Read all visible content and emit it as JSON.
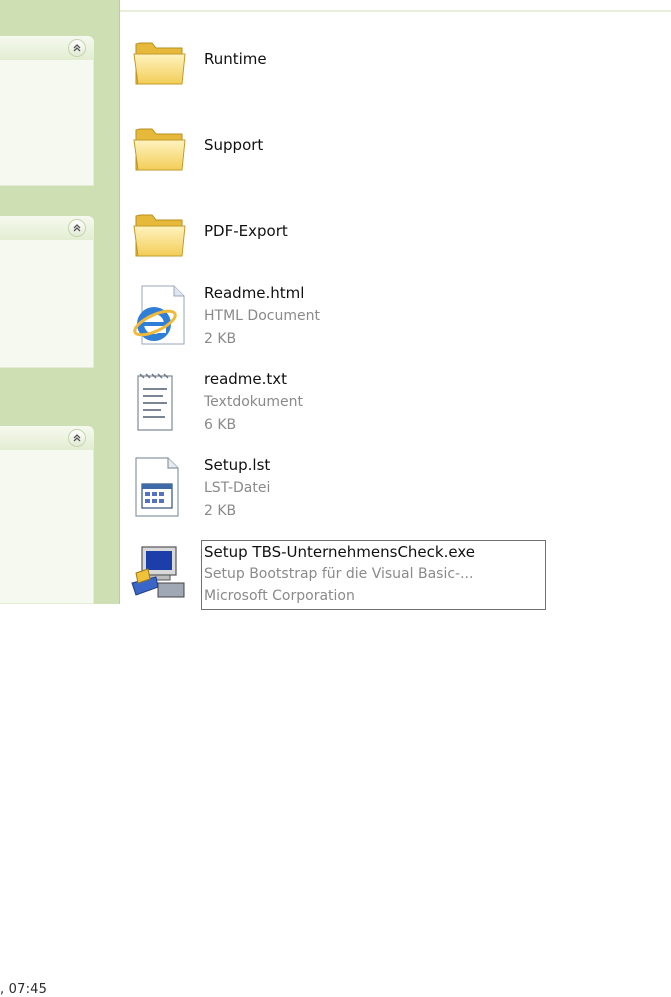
{
  "taskpane": {
    "panels": [
      {
        "collapse_icon": "chevron-double-up-icon"
      },
      {
        "collapse_icon": "chevron-double-up-icon"
      },
      {
        "collapse_icon": "chevron-double-up-icon"
      }
    ],
    "details_time": ", 07:45"
  },
  "files": [
    {
      "name": "Runtime",
      "icon": "folder-icon"
    },
    {
      "name": "Support",
      "icon": "folder-icon"
    },
    {
      "name": "PDF-Export",
      "icon": "folder-icon"
    },
    {
      "name": "Readme.html",
      "type": "HTML Document",
      "size": "2 KB",
      "icon": "html-document-icon"
    },
    {
      "name": "readme.txt",
      "type": "Textdokument",
      "size": "6 KB",
      "icon": "text-document-icon"
    },
    {
      "name": "Setup.lst",
      "type": "LST-Datei",
      "size": "2 KB",
      "icon": "lst-file-icon"
    },
    {
      "name": "Setup TBS-UnternehmensCheck.exe",
      "type": "Setup Bootstrap für die Visual Basic-...",
      "company": "Microsoft Corporation",
      "icon": "setup-exe-icon"
    }
  ],
  "colors": {
    "taskpane_bg": "#cddfb3",
    "panel_bg": "#f6f9f0",
    "secondary_text": "#8a8a8a"
  }
}
